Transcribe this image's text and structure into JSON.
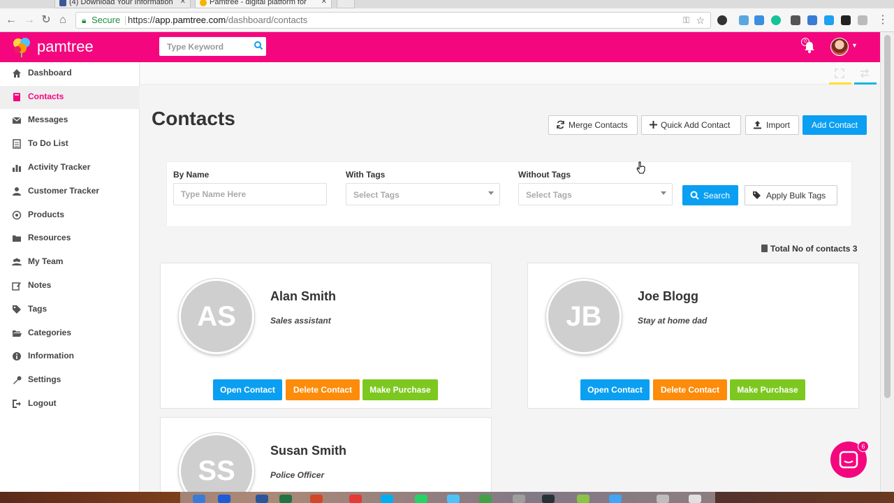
{
  "browser": {
    "tabs": [
      {
        "title": "(4) Download Your Information"
      },
      {
        "title": "Pamtree - digital platform for"
      }
    ],
    "omnibox": {
      "secure_label": "Secure",
      "url_scheme": "https://",
      "url_host": "app.pamtree.com",
      "url_path": "/dashboard/contacts"
    }
  },
  "header": {
    "logo_text": "pamtree",
    "search_placeholder": "Type Keyword",
    "notification_count": "0",
    "accent_color": "#f4077e"
  },
  "sidebar": {
    "items": [
      {
        "label": "Dashboard",
        "icon": "home-icon"
      },
      {
        "label": "Contacts",
        "icon": "book-icon"
      },
      {
        "label": "Messages",
        "icon": "envelope-icon"
      },
      {
        "label": "To Do List",
        "icon": "list-icon"
      },
      {
        "label": "Activity Tracker",
        "icon": "bar-chart-icon"
      },
      {
        "label": "Customer Tracker",
        "icon": "user-icon"
      },
      {
        "label": "Products",
        "icon": "target-icon"
      },
      {
        "label": "Resources",
        "icon": "folder-icon"
      },
      {
        "label": "My Team",
        "icon": "group-icon"
      },
      {
        "label": "Notes",
        "icon": "edit-icon"
      },
      {
        "label": "Tags",
        "icon": "tags-icon"
      },
      {
        "label": "Categories",
        "icon": "folder-open-icon"
      },
      {
        "label": "Information",
        "icon": "info-icon"
      },
      {
        "label": "Settings",
        "icon": "wrench-icon"
      },
      {
        "label": "Logout",
        "icon": "logout-icon"
      }
    ],
    "active": "Contacts"
  },
  "page": {
    "title": "Contacts",
    "actions": {
      "merge": "Merge Contacts",
      "quick_add": "Quick Add Contact",
      "import": "Import",
      "add": "Add Contact"
    },
    "filters": {
      "by_name_label": "By Name",
      "by_name_placeholder": "Type Name Here",
      "with_tags_label": "With Tags",
      "with_tags_placeholder": "Select Tags",
      "without_tags_label": "Without Tags",
      "without_tags_placeholder": "Select Tags",
      "search_button": "Search",
      "bulk_tags_button": "Apply Bulk Tags"
    },
    "total_label": "Total No of contacts 3"
  },
  "contacts": [
    {
      "initials": "AS",
      "name": "Alan Smith",
      "role": "Sales assistant"
    },
    {
      "initials": "JB",
      "name": "Joe Blogg",
      "role": "Stay at home dad"
    },
    {
      "initials": "SS",
      "name": "Susan Smith",
      "role": "Police Officer"
    }
  ],
  "card_actions": {
    "open": "Open Contact",
    "delete": "Delete Contact",
    "purchase": "Make Purchase"
  },
  "chat": {
    "badge": "6"
  }
}
